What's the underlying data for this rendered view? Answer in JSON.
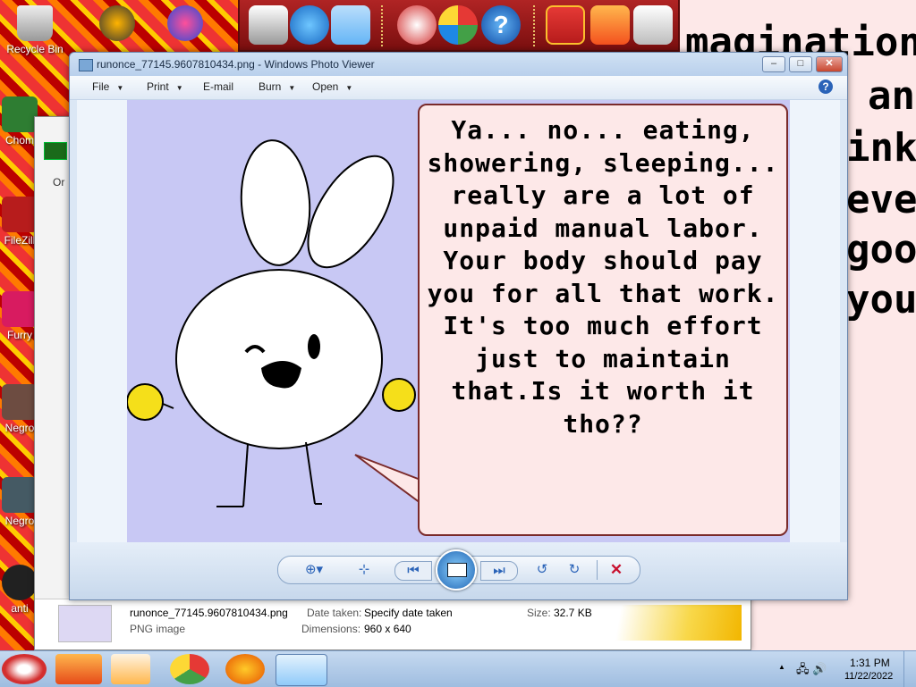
{
  "desktop": {
    "icons": [
      {
        "label": "Recycle Bin"
      },
      {
        "label": "Chom"
      },
      {
        "label": "FileZill"
      },
      {
        "label": "Furry"
      },
      {
        "label": "Negro"
      },
      {
        "label": "Negro"
      },
      {
        "label": "anti"
      }
    ],
    "background_text": [
      "magination",
      "an",
      "ink",
      "ever",
      "goo",
      "you"
    ]
  },
  "background_window": {
    "tab_label": "Or"
  },
  "viewer": {
    "title": "runonce_77145.9607810434.png - Windows Photo Viewer",
    "menu": {
      "file": "File",
      "print": "Print",
      "email": "E-mail",
      "burn": "Burn",
      "open": "Open"
    },
    "help": "?",
    "image_text": "Ya... no... eating, showering, sleeping... really are a lot of unpaid manual labor. Your body should pay you for all that work. It's too much effort just to maintain that.Is it worth it tho??"
  },
  "details": {
    "filename": "runonce_77145.9607810434.png",
    "filetype": "PNG image",
    "date_taken_label": "Date taken:",
    "date_taken_value": "Specify date taken",
    "dimensions_label": "Dimensions:",
    "dimensions_value": "960 x 640",
    "size_label": "Size:",
    "size_value": "32.7 KB"
  },
  "taskbar": {
    "time": "1:31 PM",
    "date": "11/22/2022"
  },
  "colors": {
    "bubble_fill": "#fde8e8",
    "image_bg": "#c8c8f4",
    "delete_red": "#c8102e"
  }
}
